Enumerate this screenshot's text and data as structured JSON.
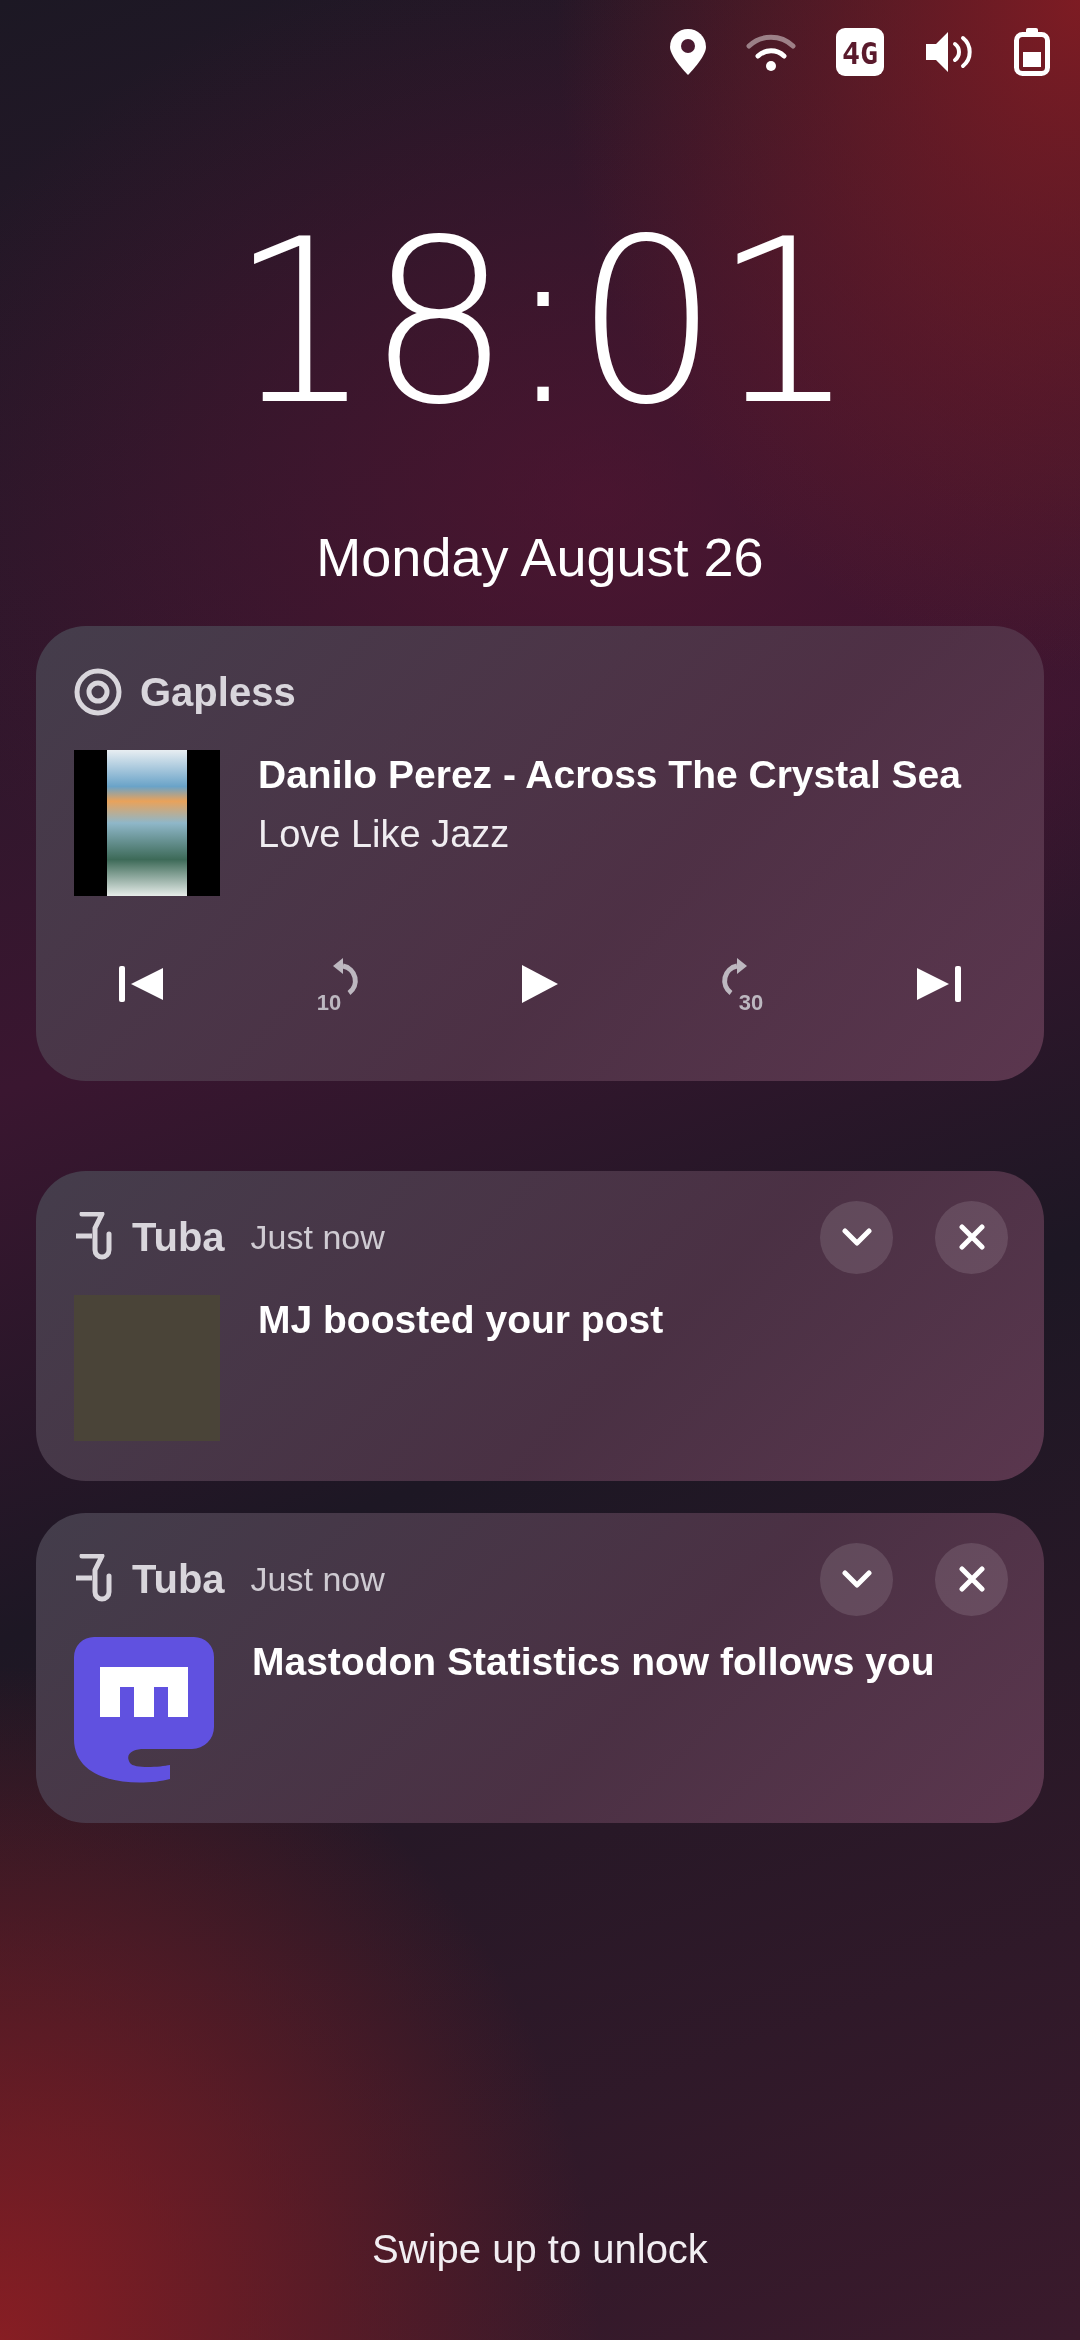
{
  "status_bar": {
    "network": "4G"
  },
  "clock": {
    "time": "18:01",
    "date": "Monday August 26"
  },
  "media": {
    "app": "Gapless",
    "title": "Danilo Perez - Across The Crystal Sea",
    "artist": "Love Like Jazz",
    "controls": [
      {
        "kind": "previous"
      },
      {
        "kind": "rewind",
        "label": "10"
      },
      {
        "kind": "play"
      },
      {
        "kind": "forward",
        "label": "30"
      },
      {
        "kind": "next"
      }
    ]
  },
  "notifications": [
    {
      "app": "Tuba",
      "time": "Just now",
      "body": "MJ boosted your post",
      "kind": "photo"
    },
    {
      "app": "Tuba",
      "time": "Just now",
      "body": "Mastodon Statistics now follows you",
      "kind": "mastodon"
    }
  ],
  "hint": "Swipe up to unlock"
}
